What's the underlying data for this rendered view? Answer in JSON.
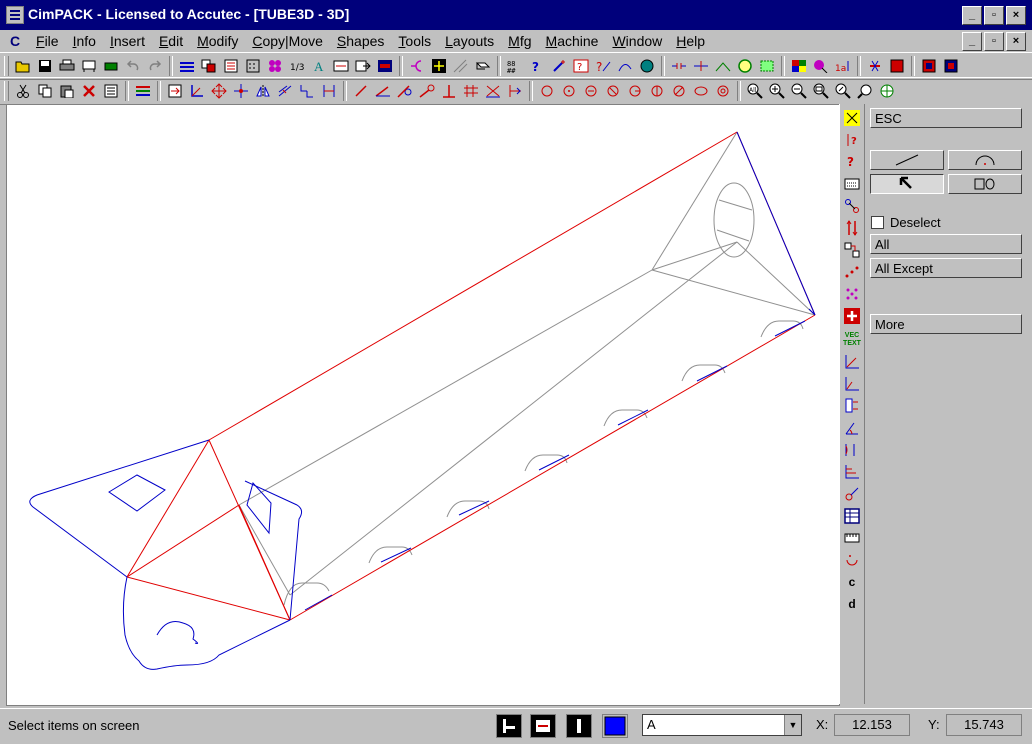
{
  "window": {
    "title": "CimPACK - Licensed to Accutec - [TUBE3D - 3D]",
    "minimize": "_",
    "maximize": "▫",
    "close": "×"
  },
  "menu": {
    "app_icon": "C",
    "items": [
      "File",
      "Info",
      "Insert",
      "Edit",
      "Modify",
      "Copy|Move",
      "Shapes",
      "Tools",
      "Layouts",
      "Mfg",
      "Machine",
      "Window",
      "Help"
    ]
  },
  "side_icons": {
    "vec_text": "VEC TEXT",
    "c": "c",
    "d": "d"
  },
  "panel": {
    "esc": "ESC",
    "deselect": "Deselect",
    "all": "All",
    "all_except": "All Except",
    "more": "More"
  },
  "status": {
    "message": "Select items on screen",
    "layer": "A",
    "x_label": "X:",
    "x_value": "12.153",
    "y_label": "Y:",
    "y_value": "15.743"
  },
  "colors": {
    "title_bar": "#00007b",
    "outline_blue": "#0000c8",
    "fold_red": "#e00000",
    "face_gray": "#909090",
    "current_color": "#0000ff"
  }
}
